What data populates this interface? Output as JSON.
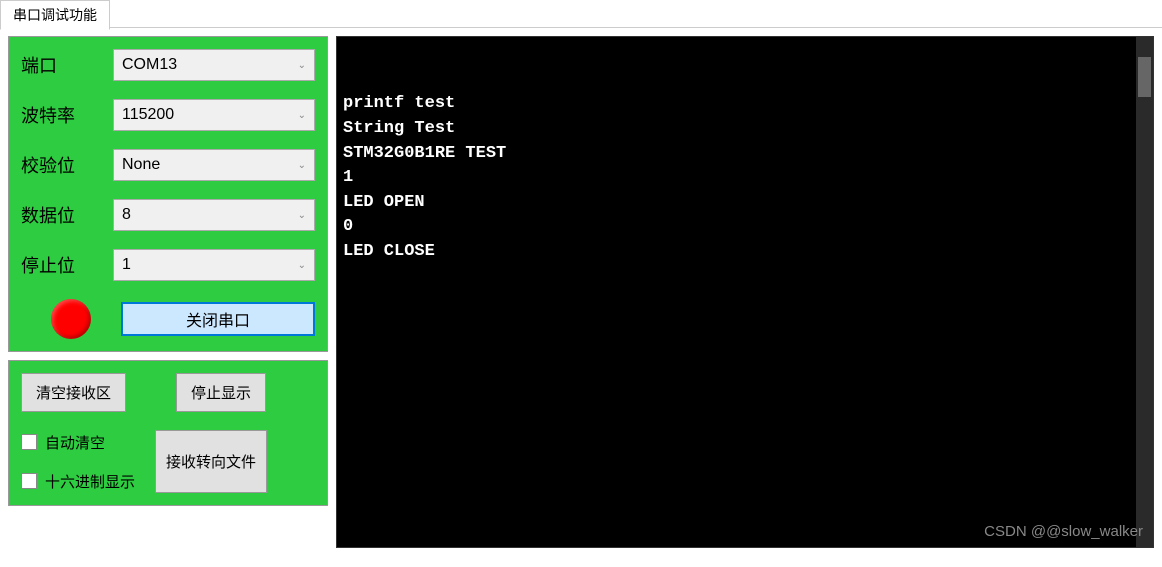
{
  "tab": {
    "label": "串口调试功能"
  },
  "config": {
    "port_label": "端口",
    "port_value": "COM13",
    "baud_label": "波特率",
    "baud_value": "115200",
    "parity_label": "校验位",
    "parity_value": "None",
    "databits_label": "数据位",
    "databits_value": "8",
    "stopbits_label": "停止位",
    "stopbits_value": "1",
    "close_port_label": "关闭串口",
    "status_color": "#ff0000"
  },
  "receive": {
    "clear_label": "清空接收区",
    "stop_label": "停止显示",
    "auto_clear_label": "自动清空",
    "hex_display_label": "十六进制显示",
    "to_file_label": "接收转向文件"
  },
  "terminal": {
    "lines": [
      "printf test",
      "String Test",
      "STM32G0B1RE TEST",
      "1",
      "LED OPEN",
      "0",
      "LED CLOSE"
    ],
    "watermark": "CSDN @@slow_walker"
  }
}
